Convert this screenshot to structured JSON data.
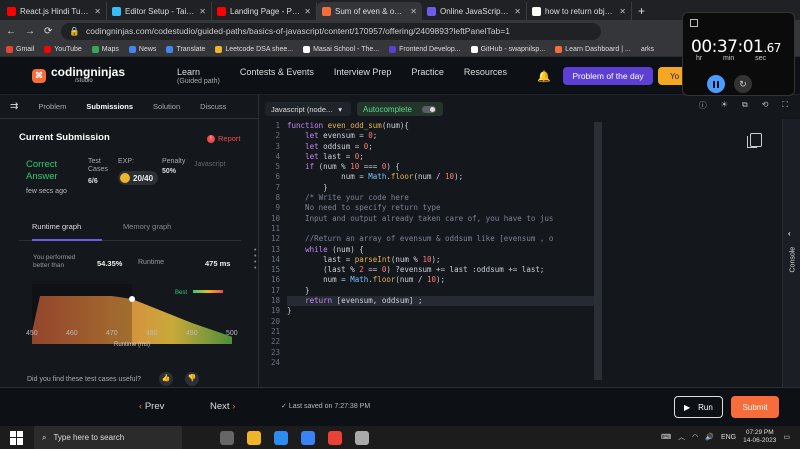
{
  "browser": {
    "tabs": [
      {
        "title": "React.js Hindi Tutorial",
        "color": "#ff0000"
      },
      {
        "title": "Editor Setup - Tailwind",
        "color": "#38bdf8"
      },
      {
        "title": "Landing Page - Project",
        "color": "#ff0000"
      },
      {
        "title": "Sum of even & odd -",
        "color": "#f66c3b"
      },
      {
        "title": "Online JavaScript Com",
        "color": "#6c5ce7"
      },
      {
        "title": "how to return object a",
        "color": "#ffffff"
      }
    ],
    "new_tab": "+",
    "url": "codingninjas.com/codestudio/guided-paths/basics-of-javascript/content/170957/offering/2409893?leftPanelTab=1",
    "bookmarks": [
      {
        "label": "Gmail",
        "color": "#ea4335"
      },
      {
        "label": "YouTube",
        "color": "#ff0000"
      },
      {
        "label": "Maps",
        "color": "#34a853"
      },
      {
        "label": "News",
        "color": "#4285f4"
      },
      {
        "label": "Translate",
        "color": "#4285f4"
      },
      {
        "label": "Leetcode DSA shee...",
        "color": "#f0b429"
      },
      {
        "label": "Masai School - The...",
        "color": "#ffffff"
      },
      {
        "label": "Frontend Develop...",
        "color": "#5c3fd4"
      },
      {
        "label": "GitHub - swapnilsp...",
        "color": "#ffffff"
      },
      {
        "label": "Learn Dashboard | ...",
        "color": "#f66c3b"
      }
    ],
    "bookmarks_more": "arks"
  },
  "site": {
    "logo_name": "codingninjas",
    "logo_sub": "/studio",
    "nav": [
      {
        "label": "Learn",
        "sub": "(Guided path)"
      },
      {
        "label": "Contests & Events",
        "sub": ""
      },
      {
        "label": "Interview Prep",
        "sub": ""
      },
      {
        "label": "Practice",
        "sub": ""
      },
      {
        "label": "Resources",
        "sub": ""
      }
    ],
    "problem_of_day": "Problem of the day",
    "you_btn": "Yo"
  },
  "left_panel": {
    "tabs": [
      "Problem",
      "Submissions",
      "Solution",
      "Discuss"
    ],
    "active_tab": "Submissions",
    "heading": "Current Submission",
    "report": "Report",
    "status": "Correct Answer",
    "status_line1": "Correct",
    "status_line2": "Answer",
    "ago": "few secs ago",
    "test_cases_label": "Test Cases",
    "test_cases": "6/6",
    "exp_label": "EXP:",
    "exp_value": "20/40",
    "penalty_label": "Penalty",
    "penalty_value": "50%",
    "language": "Javascript",
    "graph_tabs": [
      "Runtime graph",
      "Memory graph"
    ],
    "performed_label": "You performed better than",
    "performed_value": "54.35%",
    "runtime_label": "Runtime",
    "runtime_value": "475 ms",
    "feedback_q": "Did you find these test cases useful?",
    "thumbs_up": "👍",
    "thumbs_down": "👎"
  },
  "chart_data": {
    "type": "area",
    "x": [
      450,
      460,
      470,
      480,
      490,
      500
    ],
    "xlabel": "Runtime (ms)",
    "legend": "Best",
    "marker_x": 475,
    "xlim": [
      450,
      500
    ],
    "profile": [
      {
        "x": 450,
        "y": 0.2
      },
      {
        "x": 452,
        "y": 0.8
      },
      {
        "x": 470,
        "y": 0.8
      },
      {
        "x": 475,
        "y": 0.75
      },
      {
        "x": 490,
        "y": 0.35
      },
      {
        "x": 500,
        "y": 0.12
      }
    ]
  },
  "editor": {
    "language": "Javascript (node...",
    "autocomplete": "Autocomplete",
    "icons": [
      "ⓘ",
      "☀",
      "⧉",
      "⟲",
      "⛶"
    ],
    "line_numbers": [
      "1",
      "2",
      "3",
      "4",
      "5",
      "6",
      "7",
      "8",
      "9",
      "10",
      "11",
      "12",
      "13",
      "14",
      "15",
      "16",
      "17",
      "18",
      "19",
      "20",
      "21",
      "22",
      "23",
      "24"
    ],
    "highlight_line": 18
  },
  "bottom": {
    "prev": "Prev",
    "next": "Next",
    "saved": "Last saved on 7:27:38 PM",
    "run": "Run",
    "submit": "Submit",
    "console": "Console"
  },
  "timer": {
    "time": "00:37:01",
    "ms": ".67",
    "units": [
      "hr",
      "min",
      "sec"
    ]
  },
  "taskbar": {
    "search_placeholder": "Type here to search",
    "lang": "ENG",
    "time": "07:29 PM",
    "date": "14-06-2023"
  }
}
